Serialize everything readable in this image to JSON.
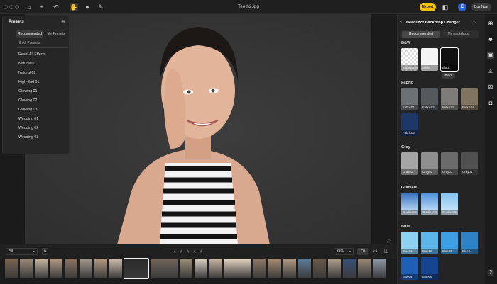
{
  "window": {
    "title": "Teeth2.jpg"
  },
  "toolbar": {
    "export_label": "Export",
    "avatar_letter": "E",
    "buy_label": "Buy Now"
  },
  "presets": {
    "title": "Presets",
    "tabs": [
      "Recommended",
      "My Presets"
    ],
    "all_label": "All Presets",
    "items": [
      "Reset All Effects",
      "Natural 01",
      "Natural 02",
      "High-End 01",
      "Glowing 01",
      "Glowing 02",
      "Glowing 03",
      "Wedding 01",
      "Wedding 02",
      "Wedding 03"
    ]
  },
  "bottom": {
    "filter_value": "All",
    "zoom": "31%",
    "fit_label": "Fit",
    "one_to_one": "1:1",
    "rating_max": 5
  },
  "right": {
    "title": "Headshot Backdrop Changer",
    "tabs": [
      "Recommended",
      "My backdrops"
    ],
    "tooltip": "Black",
    "sections": [
      {
        "name": "B&W",
        "swatches": [
          {
            "label": "Transparent",
            "color": "#e8e8e8"
          },
          {
            "label": "White",
            "color": "#f4f4f4"
          },
          {
            "label": "Black",
            "color": "#111111"
          }
        ]
      },
      {
        "name": "Fabric",
        "swatches": [
          {
            "label": "Fabric01",
            "color": "#6d7174"
          },
          {
            "label": "Fabric02",
            "color": "#55595c"
          },
          {
            "label": "Fabric03",
            "color": "#7c7b77"
          },
          {
            "label": "Fabric04",
            "color": "#7f7460"
          },
          {
            "label": "Fabric05",
            "color": "#1d3766"
          }
        ]
      },
      {
        "name": "Gray",
        "swatches": [
          {
            "label": "Gray01",
            "color": "#a5a5a5"
          },
          {
            "label": "Gray02",
            "color": "#8f8f8f"
          },
          {
            "label": "Gray03",
            "color": "#6b6b6b"
          },
          {
            "label": "Gray04",
            "color": "#505050"
          }
        ]
      },
      {
        "name": "Gradient",
        "swatches": [
          {
            "label": "Gradient01",
            "color": "#2f6fbf"
          },
          {
            "label": "Gradient02",
            "color": "#4a8fdc"
          },
          {
            "label": "Gradient03",
            "color": "#7fc2ef"
          }
        ]
      },
      {
        "name": "Blue",
        "swatches": [
          {
            "label": "Blue01",
            "color": "#8ed2f1"
          },
          {
            "label": "Blue02",
            "color": "#5cb6ea"
          },
          {
            "label": "Blue03",
            "color": "#3f9fe4"
          },
          {
            "label": "Blue04",
            "color": "#2f83c4"
          },
          {
            "label": "Blue05",
            "color": "#1f5fb6"
          },
          {
            "label": "Blue06",
            "color": "#16458f"
          }
        ]
      }
    ]
  },
  "colors": {
    "accent": "#f2c200",
    "avatar": "#2b60d9"
  },
  "filmstrip": [
    "#7a6552",
    "#9a8b7a",
    "#c9b8a4",
    "#b39c86",
    "#8b7565",
    "#a49a8f",
    "#b59b84",
    "#d0c0b0",
    "#2a2a2a",
    "#70655a",
    "#9c8f77",
    "#d9d2c8",
    "#c9b7a5",
    "#e6d7c4",
    "#8d7a68",
    "#a58c70",
    "#b49a80",
    "#5e7e9a",
    "#6a5a4a",
    "#b0a08e",
    "#39507a",
    "#9a8a76",
    "#8f9aa8"
  ]
}
